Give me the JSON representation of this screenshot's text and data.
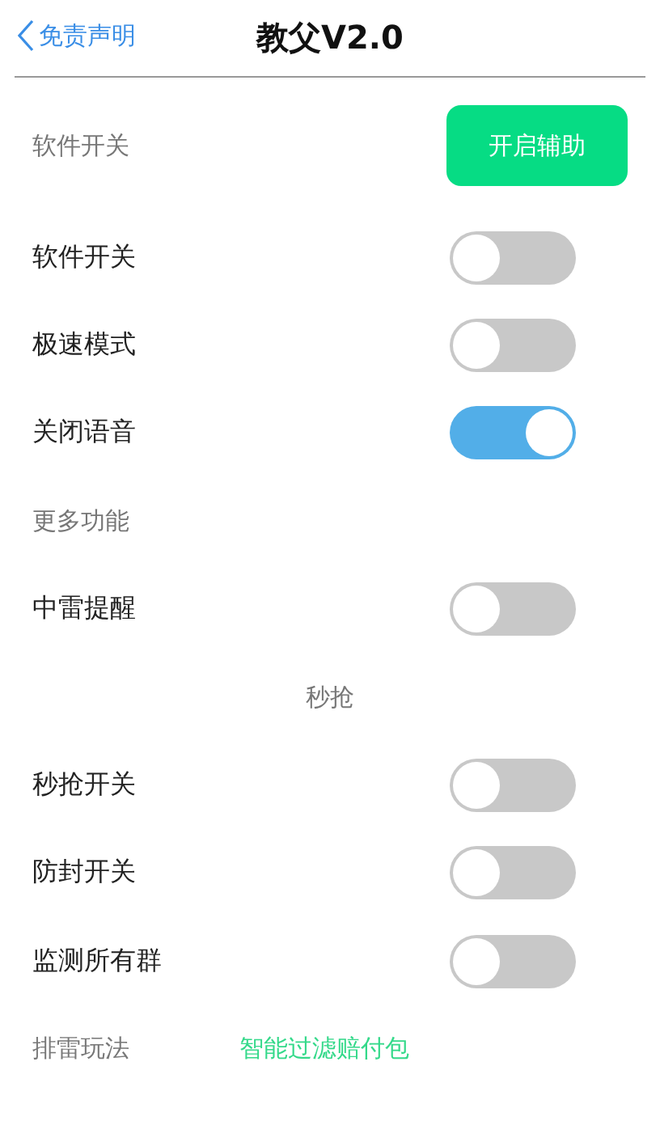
{
  "header": {
    "back_label": "免责声明",
    "title": "教父V2.0"
  },
  "rows": [
    {
      "kind": "section",
      "label": "软件开关",
      "button": "开启辅助"
    },
    {
      "kind": "toggle",
      "label": "软件开关",
      "on": false
    },
    {
      "kind": "toggle",
      "label": "极速模式",
      "on": false
    },
    {
      "kind": "toggle",
      "label": "关闭语音",
      "on": true
    },
    {
      "kind": "section",
      "label": "更多功能"
    },
    {
      "kind": "toggle",
      "label": "中雷提醒",
      "on": false
    },
    {
      "kind": "center",
      "label": "秒抢"
    },
    {
      "kind": "toggle",
      "label": "秒抢开关",
      "on": false
    },
    {
      "kind": "toggle",
      "label": "防封开关",
      "on": false
    },
    {
      "kind": "toggle",
      "label": "监测所有群",
      "on": false
    },
    {
      "kind": "section",
      "label": "排雷玩法",
      "link": "智能过滤赔付包"
    }
  ]
}
